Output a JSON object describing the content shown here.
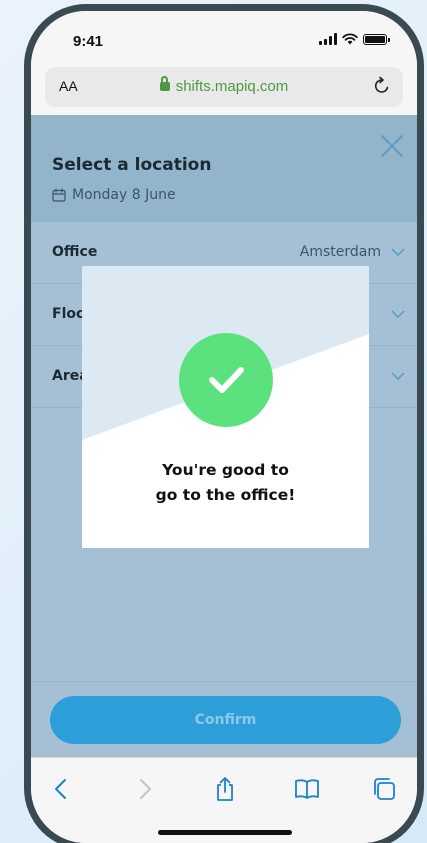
{
  "status_bar": {
    "time": "9:41"
  },
  "browser": {
    "text_size_label": "AA",
    "url": "shifts.mapiq.com",
    "reload_icon": "reload-icon",
    "toolbar_icons": [
      "back-icon",
      "forward-icon",
      "share-icon",
      "bookmarks-icon",
      "tabs-icon"
    ]
  },
  "page": {
    "title": "Select a location",
    "date": "Monday 8 June",
    "rows": [
      {
        "label": "Office",
        "value": "Amsterdam"
      },
      {
        "label": "Floor",
        "value": ""
      },
      {
        "label": "Area",
        "value": ""
      }
    ],
    "confirm_label": "Confirm"
  },
  "modal": {
    "line1": "You're good to",
    "line2": "go to the office!",
    "icon": "check-circle-icon"
  },
  "colors": {
    "success": "#5be27f",
    "accent": "#2d9fd8",
    "url_green": "#4d9b3f"
  }
}
